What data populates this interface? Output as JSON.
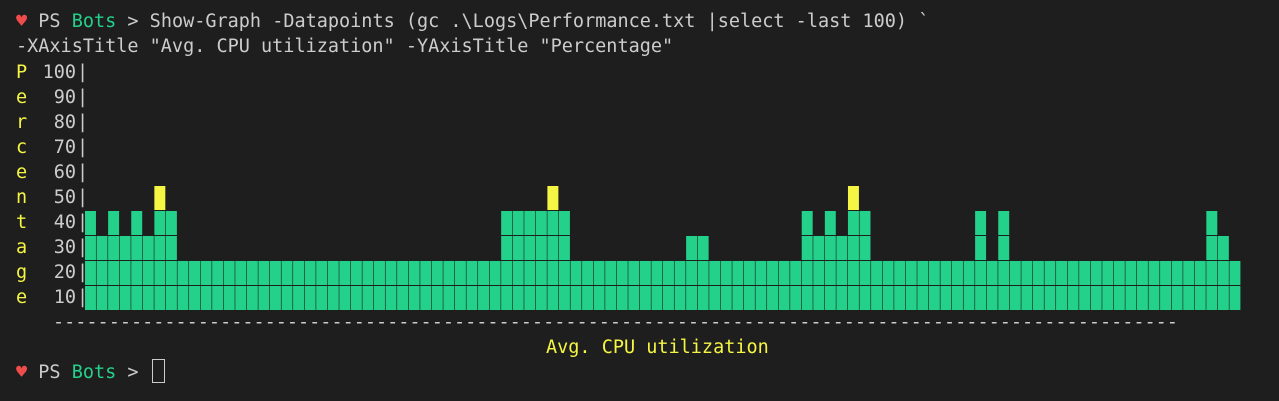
{
  "prompt": {
    "heart": "♥",
    "ps": "PS ",
    "location": "Bots",
    "arrow": " >"
  },
  "command": {
    "line1": " Show-Graph -Datapoints (gc .\\Logs\\Performance.txt |select -last 100) `",
    "line2": "-XAxisTitle \"Avg. CPU utilization\" -YAxisTitle \"Percentage\""
  },
  "colors": {
    "background": "#1e1e1e",
    "green": "#23d18b",
    "yellow": "#f5f543",
    "red": "#f14c4c",
    "text": "#cccccc"
  },
  "chart_data": {
    "type": "bar",
    "xlabel": "Avg. CPU utilization",
    "ylabel": "Percentage",
    "ylim": [
      0,
      100
    ],
    "y_ticks": [
      "100",
      "90",
      "80",
      "70",
      "60",
      "50",
      "40",
      "30",
      "20",
      "10"
    ],
    "baseline": "-----------------------------------------------------------------------------------------------------",
    "color_thresholds": {
      "green_max": 40,
      "yellow_max": 70,
      "red_above": 70
    },
    "values": [
      40,
      30,
      40,
      30,
      40,
      30,
      50,
      40,
      20,
      20,
      20,
      20,
      20,
      20,
      20,
      20,
      20,
      20,
      20,
      20,
      20,
      20,
      20,
      20,
      20,
      20,
      20,
      20,
      20,
      20,
      20,
      20,
      20,
      20,
      20,
      20,
      40,
      40,
      40,
      40,
      50,
      40,
      20,
      20,
      20,
      20,
      20,
      20,
      20,
      20,
      20,
      20,
      30,
      30,
      20,
      20,
      20,
      20,
      20,
      20,
      20,
      20,
      40,
      30,
      40,
      30,
      50,
      40,
      20,
      20,
      20,
      20,
      20,
      20,
      20,
      20,
      20,
      40,
      20,
      40,
      20,
      20,
      20,
      20,
      20,
      20,
      20,
      20,
      20,
      20,
      20,
      20,
      20,
      20,
      20,
      20,
      20,
      40,
      30,
      20
    ]
  }
}
